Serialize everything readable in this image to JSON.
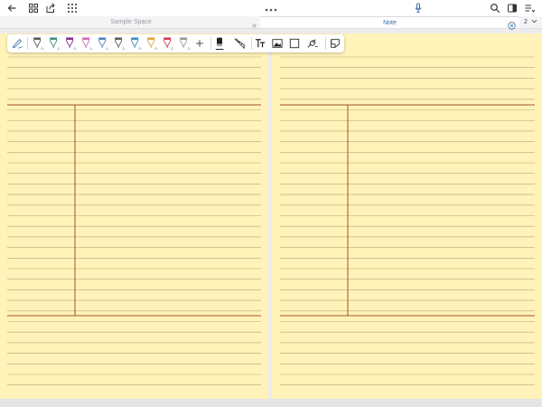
{
  "topbar": {
    "buttons": [
      {
        "name": "back-icon"
      },
      {
        "name": "grid-view-icon"
      },
      {
        "name": "share-export-icon"
      },
      {
        "name": "apps-icon"
      },
      {
        "name": "more-dots-icon"
      },
      {
        "name": "microphone-icon"
      },
      {
        "name": "search-icon"
      },
      {
        "name": "sidebar-panel-icon"
      },
      {
        "name": "list-menu-icon"
      }
    ]
  },
  "tabs": [
    {
      "label": "Sample Space",
      "active": false
    },
    {
      "label": "Note",
      "active": true
    }
  ],
  "page_selector": {
    "value": "2"
  },
  "toolbar": {
    "pens": [
      {
        "size": "0.5",
        "color": "#5a5a5a"
      },
      {
        "size": "1.0",
        "color": "#3d8f86"
      },
      {
        "size": "0.5",
        "color": "#8a2a8a"
      },
      {
        "size": "1.0",
        "color": "#d06ab0"
      },
      {
        "size": "1.5",
        "color": "#4f7fc0"
      },
      {
        "size": "2.0",
        "color": "#5a5a5a"
      },
      {
        "size": "0.5",
        "color": "#3b8ec9"
      },
      {
        "size": "0.5",
        "color": "#e2a23a"
      },
      {
        "size": "1.0",
        "color": "#d13a55"
      },
      {
        "size": "2.0",
        "color": "#9a9a9a"
      }
    ],
    "active_color": "#222222"
  },
  "notebook": {
    "paper_color": "#fff3b9",
    "rule_color": "#b8a678",
    "margin_color": "#a0502a"
  }
}
